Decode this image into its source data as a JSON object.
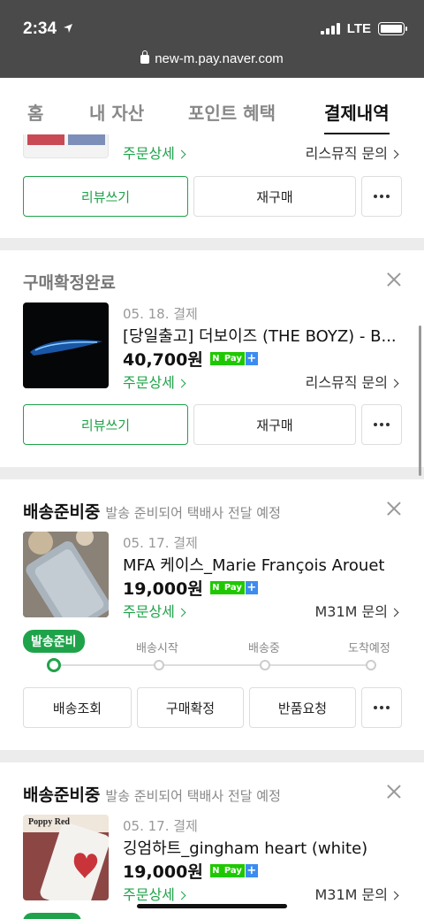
{
  "status_bar": {
    "time": "2:34",
    "network": "LTE",
    "url": "new-m.pay.naver.com"
  },
  "tabs": [
    {
      "label": "홈"
    },
    {
      "label": "내 자산"
    },
    {
      "label": "포인트 혜택"
    },
    {
      "label": "결제내역"
    }
  ],
  "order0": {
    "detail_link": "주문상세",
    "inquiry_link": "리스뮤직 문의",
    "review_button": "리뷰쓰기",
    "rebuy_button": "재구매"
  },
  "order1": {
    "status": "구매확정완료",
    "date": "05. 18. 결제",
    "name": "[당일출고] 더보이즈 (THE BOYZ) - B...",
    "price": "40,700원",
    "detail_link": "주문상세",
    "inquiry_link": "리스뮤직 문의",
    "review_button": "리뷰쓰기",
    "rebuy_button": "재구매"
  },
  "order2": {
    "status": "배송준비중",
    "status_sub": "발송 준비되어 택배사 전달 예정",
    "date": "05. 17. 결제",
    "name": "MFA 케이스_Marie François Arouet",
    "price": "19,000원",
    "detail_link": "주문상세",
    "inquiry_link": "M31M 문의",
    "tracker": {
      "current": "발송준비",
      "steps": [
        "배송시작",
        "배송중",
        "도착예정"
      ]
    },
    "buttons": [
      "배송조회",
      "구매확정",
      "반품요청"
    ]
  },
  "order3": {
    "status": "배송준비중",
    "status_sub": "발송 준비되어 택배사 전달 예정",
    "date": "05. 17. 결제",
    "name": "깅엄하트_gingham heart (white)",
    "price": "19,000원",
    "detail_link": "주문상세",
    "inquiry_link": "M31M 문의",
    "thumb_label": "Poppy Red"
  },
  "npay_badge": {
    "n": "N",
    "pay": "Pay",
    "plus": "+"
  },
  "colors": {
    "green": "#1fa34a",
    "npay_green": "#1ec800",
    "npay_blue": "#3c8cf0"
  }
}
